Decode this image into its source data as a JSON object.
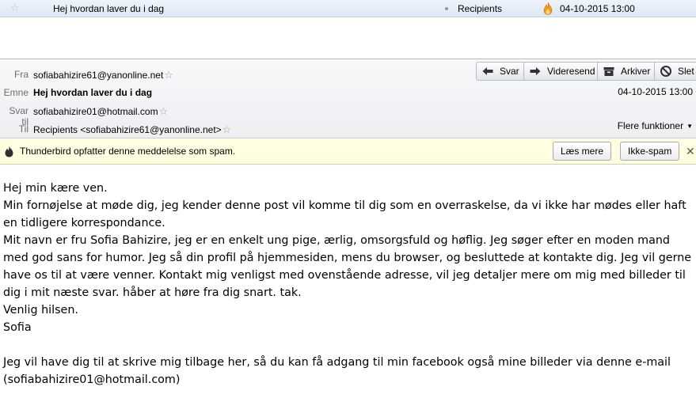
{
  "message_list": {
    "subject": "Hej hvordan laver du i dag",
    "recipients": "Recipients",
    "date": "04-10-2015 13:00"
  },
  "header": {
    "from_label": "Fra",
    "from_value": "sofiabahizire61@yanonline.net",
    "subject_label": "Emne",
    "subject_value": "Hej hvordan laver du i dag",
    "reply_to_label": "Svar til",
    "reply_to_value": "sofiabahizire01@hotmail.com",
    "to_label": "Til",
    "to_value": "Recipients <sofiabahizire61@yanonline.net>",
    "date": "04-10-2015 13:00",
    "more_functions": "Flere funktioner"
  },
  "toolbar": {
    "reply": "Svar",
    "forward": "Videresend",
    "archive": "Arkiver",
    "delete": "Slet"
  },
  "spam_bar": {
    "message": "Thunderbird opfatter denne meddelelse som spam.",
    "learn_more": "Læs mere",
    "not_spam": "Ikke-spam"
  },
  "body": {
    "p1": "Hej min kære ven.",
    "p2": "Min fornøjelse at møde dig, jeg kender denne post vil komme til dig som en overraskelse, da vi ikke har mødes eller haft en tidligere korrespondance.",
    "p3": "Mit navn er fru Sofia Bahizire, jeg er en enkelt ung pige, ærlig, omsorgsfuld og høflig. Jeg søger efter en moden mand med god sans for humor. Jeg så din profil på hjemmesiden, mens du browser, og besluttede at kontakte dig. Jeg vil gerne have os til at være venner. Kontakt mig venligst med ovenstående adresse, vil jeg detaljer mere om mig med billeder til dig i mit næste svar. håber at høre fra dig snart. tak.",
    "p4": "Venlig hilsen.",
    "p5": "Sofia",
    "p6": "Jeg vil have dig til at skrive mig tilbage her, så du kan få adgang til min facebook også mine billeder via denne e-mail (sofiabahizire01@hotmail.com)"
  },
  "colors": {
    "list_row_bg": "#dce8f6",
    "spam_bar_bg": "#fffee0",
    "header_bg": "#edeff2"
  },
  "icons": {
    "star": "star-icon",
    "flame": "junk-flame-icon",
    "reply": "reply-arrow-icon",
    "forward": "forward-arrow-icon",
    "archive": "archive-box-icon",
    "delete": "delete-circle-icon",
    "spam": "junk-flame-icon"
  }
}
